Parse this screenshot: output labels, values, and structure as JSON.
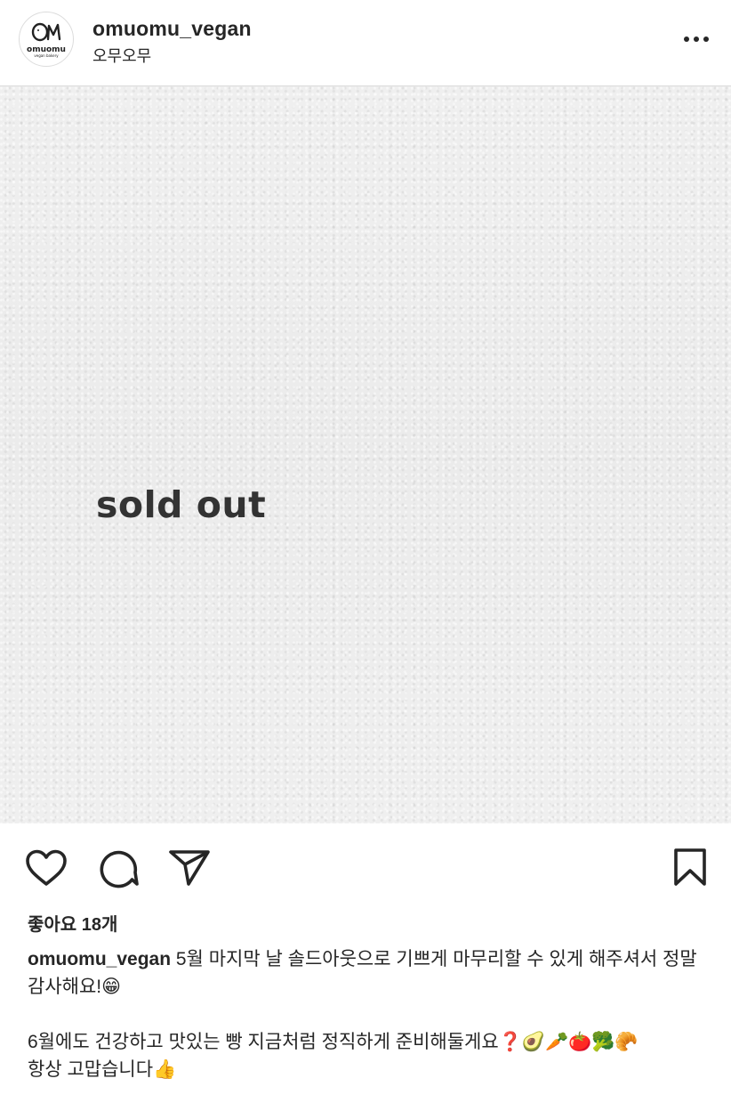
{
  "header": {
    "username": "omuomu_vegan",
    "location": "오무오무",
    "avatar_text": "omuomu",
    "avatar_subtext": "vegan bakery"
  },
  "post": {
    "image_text": "sold out"
  },
  "actions": {
    "like_icon": "heart-icon",
    "comment_icon": "comment-icon",
    "share_icon": "send-icon",
    "save_icon": "bookmark-icon"
  },
  "likes": "좋아요 18개",
  "caption": {
    "username": "omuomu_vegan",
    "line1": " 5월 마지막 날  솔드아웃으로 기쁘게 마무리할 수 있게 해주셔서 정말 감사해요!😁",
    "line2": "6월에도 건강하고 맛있는 빵 지금처럼 정직하게 준비해둘게요❓🥑🥕🍅🥦🥐",
    "line3": "항상 고맙습니다👍"
  },
  "colors": {
    "text": "#262626",
    "border": "#dbdbdb",
    "image_bg": "#eeeeee"
  }
}
